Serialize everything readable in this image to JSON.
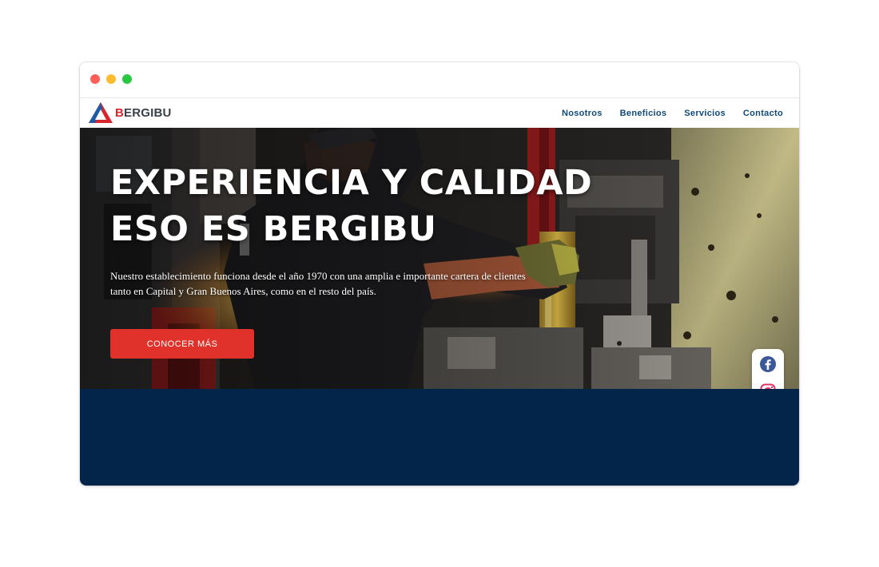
{
  "brand": {
    "name": "BERGIBU",
    "first_letter": "B",
    "rest": "ERGIBU",
    "accent_color": "#d8262c",
    "brand_blue": "#0f4a7a"
  },
  "nav": {
    "items": [
      {
        "label": "Nosotros"
      },
      {
        "label": "Beneficios"
      },
      {
        "label": "Servicios"
      },
      {
        "label": "Contacto"
      }
    ]
  },
  "hero": {
    "title_line1": "EXPERIENCIA Y CALIDAD",
    "title_line2": "ESO ES BERGIBU",
    "description": "Nuestro establecimiento funciona desde el año 1970 con una amplia e importante cartera de clientes tanto en Capital y Gran Buenos Aires, como en el resto del país.",
    "cta_label": "CONOCER MÁS",
    "cta_color": "#e0312a",
    "band_color": "#03254a"
  },
  "social": {
    "items": [
      {
        "icon": "facebook-icon",
        "color": "#3b5998"
      },
      {
        "icon": "instagram-icon",
        "color": "#e1306c"
      },
      {
        "icon": "whatsapp-icon",
        "color": "#25d366"
      }
    ]
  }
}
